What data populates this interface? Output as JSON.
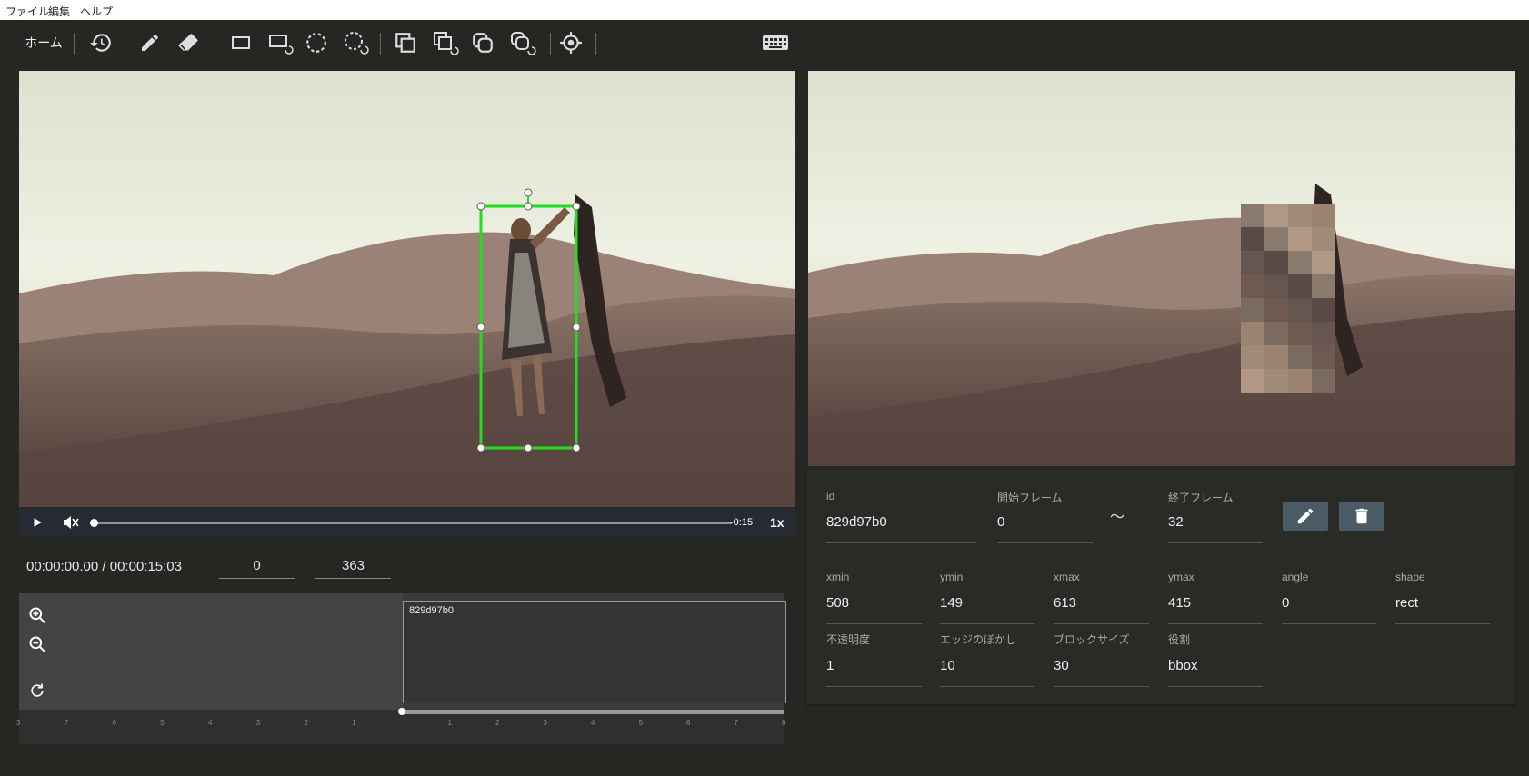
{
  "menu": {
    "file": "ファイル",
    "edit": "編集",
    "help": "ヘルプ"
  },
  "toolbar": {
    "home_label": "ホーム",
    "icons": [
      "history-icon",
      "pencil-icon",
      "eraser-icon",
      "rect-icon",
      "rect-repeat-icon",
      "ellipse-icon",
      "ellipse-repeat-icon",
      "copy-icon",
      "copy-repeat-icon",
      "copy-round-icon",
      "copy-round-repeat-icon",
      "target-icon",
      "keyboard-icon"
    ]
  },
  "player": {
    "remaining": "-0:15",
    "speed": "1x",
    "time_display": "00:00:00.00 / 00:00:15:03",
    "start_frame_value": "0",
    "end_frame_value": "363"
  },
  "timeline": {
    "track_label": "829d97b0",
    "ruler_left": [
      "3",
      "7",
      "6",
      "5",
      "4",
      "3",
      "2",
      "1"
    ],
    "ruler_right": [
      "1",
      "2",
      "3",
      "4",
      "5",
      "6",
      "7",
      "8"
    ]
  },
  "detail": {
    "id_label": "id",
    "id_value": "829d97b0",
    "start_label": "開始フレーム",
    "start_value": "0",
    "tilde": "〜",
    "end_label": "終了フレーム",
    "end_value": "32",
    "xmin_label": "xmin",
    "xmin_value": "508",
    "ymin_label": "ymin",
    "ymin_value": "149",
    "xmax_label": "xmax",
    "xmax_value": "613",
    "ymax_label": "ymax",
    "ymax_value": "415",
    "angle_label": "angle",
    "angle_value": "0",
    "shape_label": "shape",
    "shape_value": "rect",
    "opacity_label": "不透明度",
    "opacity_value": "1",
    "blur_label": "エッジのぼかし",
    "blur_value": "10",
    "block_label": "ブロックサイズ",
    "block_value": "30",
    "role_label": "役割",
    "role_value": "bbox"
  },
  "colors": {
    "bbox": "#22dd22",
    "accent_button": "#4a5b66",
    "background": "#262723"
  }
}
